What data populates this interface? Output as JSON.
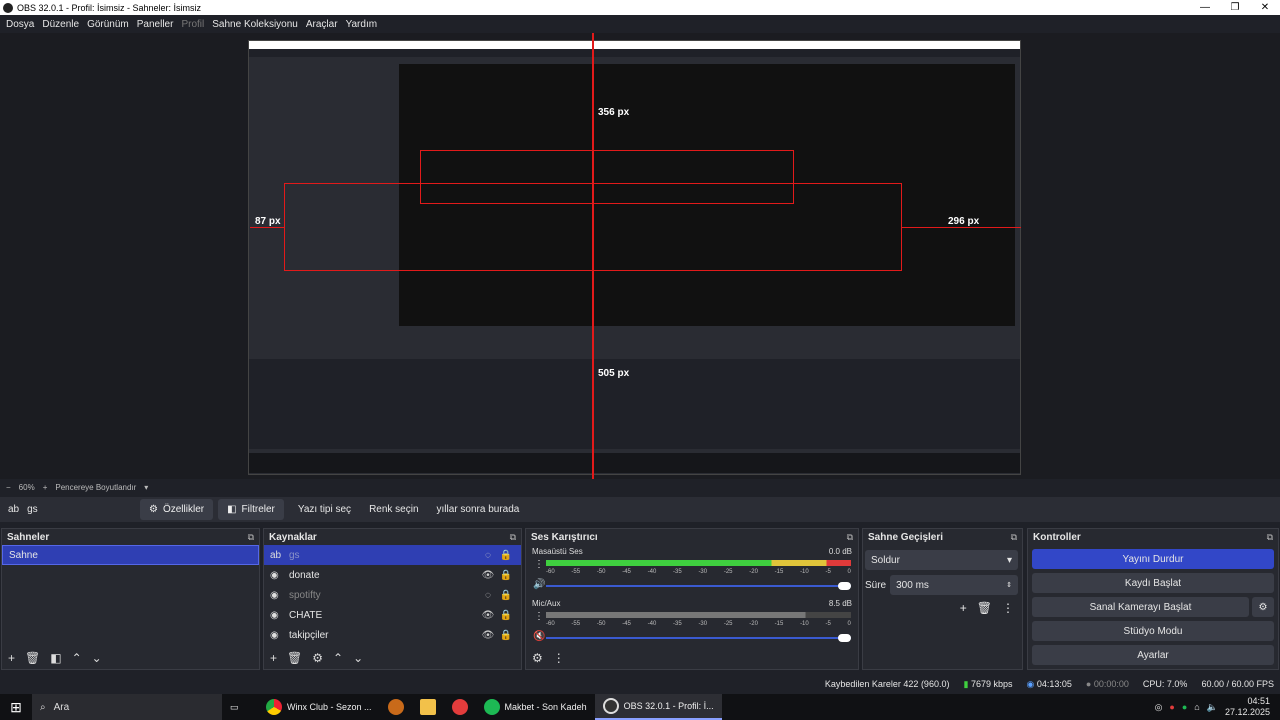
{
  "window": {
    "title": "OBS 32.0.1 - Profil: İsimsiz - Sahneler: İsimsiz",
    "min": "—",
    "max": "❐",
    "close": "✕"
  },
  "menu": {
    "items": [
      "Dosya",
      "Düzenle",
      "Görünüm",
      "Paneller",
      "Profil",
      "Sahne Koleksiyonu",
      "Araçlar",
      "Yardım"
    ]
  },
  "preview": {
    "measures": {
      "top": "356 px",
      "left": "87 px",
      "right": "296 px",
      "inner": "505 px"
    }
  },
  "zoom": {
    "minus": "−",
    "value": "60%",
    "plus": "+",
    "mode": "Pencereye Boyutlandır"
  },
  "source_toolbar": {
    "icon": "ab",
    "name": "gs",
    "props": "Özellikler",
    "filters": "Filtreler",
    "font": "Yazı tipi seç",
    "color": "Renk seçin",
    "text": "yıllar sonra burada"
  },
  "scenes": {
    "title": "Sahneler",
    "items": [
      "Sahne"
    ]
  },
  "sources": {
    "title": "Kaynaklar",
    "items": [
      {
        "icon": "ab",
        "label": "gs",
        "selected": true,
        "hidden": true
      },
      {
        "icon": "◉",
        "label": "donate",
        "selected": false,
        "hidden": false
      },
      {
        "icon": "◉",
        "label": "spotifty",
        "selected": false,
        "hidden": true
      },
      {
        "icon": "◉",
        "label": "CHATE",
        "selected": false,
        "hidden": false
      },
      {
        "icon": "◉",
        "label": "takipçiler",
        "selected": false,
        "hidden": false
      }
    ]
  },
  "mixer": {
    "title": "Ses Karıştırıcı",
    "channels": [
      {
        "name": "Masaüstü Ses",
        "db": "0.0 dB",
        "level": 1.0
      },
      {
        "name": "Mic/Aux",
        "db": "8.5 dB",
        "level": 0.85
      }
    ],
    "scale": [
      "-60",
      "-55",
      "-50",
      "-45",
      "-40",
      "-35",
      "-30",
      "-25",
      "-20",
      "-15",
      "-10",
      "-5",
      "0"
    ]
  },
  "transitions": {
    "title": "Sahne Geçişleri",
    "selected": "Soldur",
    "duration_label": "Süre",
    "duration_value": "300 ms"
  },
  "controls": {
    "title": "Kontroller",
    "buttons": [
      "Yayını Durdur",
      "Kaydı Başlat",
      "Sanal Kamerayı Başlat",
      "Stüdyo Modu",
      "Ayarlar"
    ]
  },
  "status": {
    "dropped": "Kaybedilen Kareler 422 (960.0)",
    "bitrate": "7679 kbps",
    "stream_time": "04:13:05",
    "rec_time": "00:00:00",
    "cpu": "CPU: 7.0%",
    "fps": "60.00 / 60.00 FPS"
  },
  "taskbar": {
    "search": "Ara",
    "apps": [
      "Winx Club - Sezon ...",
      "Makbet - Son Kadeh",
      "OBS 32.0.1 - Profil: İ..."
    ],
    "time": "04:51",
    "date": "27.12.2025"
  },
  "colors": {
    "accent": "#3247c8",
    "selected": "#2f3fb3",
    "meter_green": "#3fcf3f",
    "meter_yellow": "#e0c43a",
    "meter_red": "#e03a3a",
    "guide_red": "#e21a1a"
  }
}
